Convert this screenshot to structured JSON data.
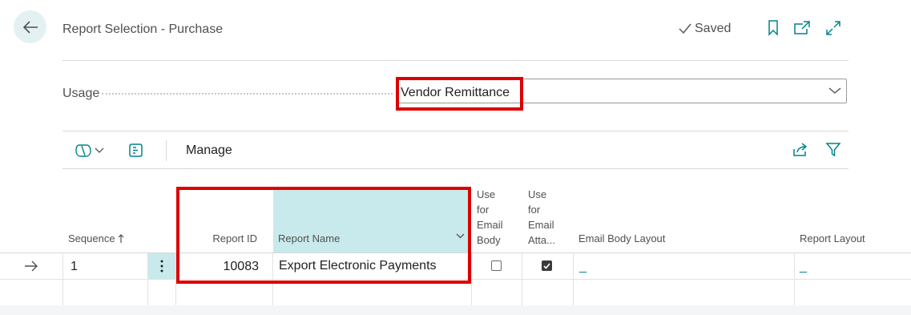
{
  "header": {
    "title": "Report Selection - Purchase",
    "saved_label": "Saved"
  },
  "usage": {
    "label": "Usage",
    "value": "Vendor Remittance"
  },
  "toolbar": {
    "manage_label": "Manage"
  },
  "columns": {
    "sequence": "Sequence",
    "report_id": "Report ID",
    "report_name": "Report Name",
    "email_body": [
      "Use",
      "for",
      "Email",
      "Body"
    ],
    "email_attachment": [
      "Use",
      "for",
      "Email",
      "Atta..."
    ],
    "email_body_layout": "Email Body Layout",
    "report_layout": "Report Layout"
  },
  "rows": [
    {
      "sequence": "1",
      "report_id": "10083",
      "report_name": "Export Electronic Payments",
      "use_for_email_body": false,
      "use_for_email_attachment": true,
      "email_body_layout": "_",
      "report_layout": "_"
    }
  ],
  "colors": {
    "accent_teal": "#008489",
    "selected_col_bg": "#c9eaec",
    "highlight_red": "#dd0000"
  },
  "icons": {
    "back": "arrow-left-icon",
    "saved": "check-icon",
    "bookmark": "bookmark-icon",
    "open_new": "open-in-new-window-icon",
    "expand": "expand-icon",
    "copilot": "copilot-icon",
    "edit_list": "edit-list-icon",
    "share": "share-icon",
    "filter": "filter-icon",
    "sort": "sort-ascending-icon",
    "dropdown": "chevron-down-icon",
    "row_arrow": "row-pointer-arrow-icon",
    "row_menu": "vertical-ellipsis-icon"
  }
}
